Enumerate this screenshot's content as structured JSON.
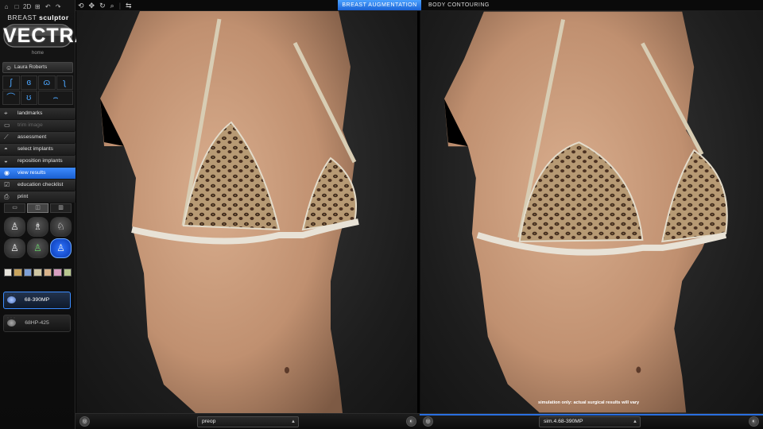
{
  "app": {
    "brand_light": "BREAST",
    "brand_bold": "sculptor",
    "logo": "VECTRA",
    "home_label": "home"
  },
  "top_icons": [
    "⌂",
    "□",
    "2D",
    "⊞",
    "↶",
    "↷"
  ],
  "toolbar_icons": [
    "⟲",
    "✥",
    "↻",
    "⌕",
    "⇆"
  ],
  "tabs": {
    "breast_augmentation": "BREAST AUGMENTATION",
    "body_contouring": "BODY CONTOURING"
  },
  "patient": {
    "name": "Laura Roberts",
    "icon": "person-icon"
  },
  "view_icons": [
    "profile-left-icon",
    "front-icon",
    "three-quarter-icon",
    "profile-right-icon",
    "chest-front-icon",
    "torso-icon",
    "chest-low-icon"
  ],
  "menu": [
    {
      "label": "landmarks",
      "icon": "landmark-icon",
      "state": "normal"
    },
    {
      "label": "trim image",
      "icon": "trim-icon",
      "state": "disabled"
    },
    {
      "label": "assessment",
      "icon": "ruler-icon",
      "state": "normal"
    },
    {
      "label": "select implants",
      "icon": "implant-icon",
      "state": "normal"
    },
    {
      "label": "reposition implants",
      "icon": "reposition-icon",
      "state": "normal"
    },
    {
      "label": "view results",
      "icon": "eye-icon",
      "state": "active"
    },
    {
      "label": "education checklist",
      "icon": "checklist-icon",
      "state": "normal"
    },
    {
      "label": "print",
      "icon": "printer-icon",
      "state": "normal"
    }
  ],
  "layout_buttons": [
    {
      "icon": "single-view-icon",
      "selected": false
    },
    {
      "icon": "split-view-icon",
      "selected": true
    },
    {
      "icon": "triple-view-icon",
      "selected": false
    }
  ],
  "mode_buttons": [
    {
      "icon": "torso-front-icon",
      "selected": false
    },
    {
      "icon": "torso-side-icon",
      "selected": false
    },
    {
      "icon": "torso-back-icon",
      "selected": false
    },
    {
      "icon": "silhouette-icon",
      "selected": false
    },
    {
      "icon": "heatmap-icon",
      "selected": false
    },
    {
      "icon": "overlay-icon",
      "selected": true
    }
  ],
  "swatches": [
    "#e7e4dc",
    "#c8a45d",
    "#7ea0d6",
    "#cfc6a2",
    "#d9b38b",
    "#d79ec0",
    "#b8c78f"
  ],
  "implants": [
    {
      "label": "68-390MP",
      "selected": true
    },
    {
      "label": "68HP-425",
      "selected": false
    }
  ],
  "bottom": {
    "left_select": "preop",
    "right_select": "sim.4.68-390MP",
    "disclaimer": "simulation only: actual surgical results will vary"
  },
  "colors": {
    "accent": "#2a78ee",
    "skin": "#c49879"
  }
}
